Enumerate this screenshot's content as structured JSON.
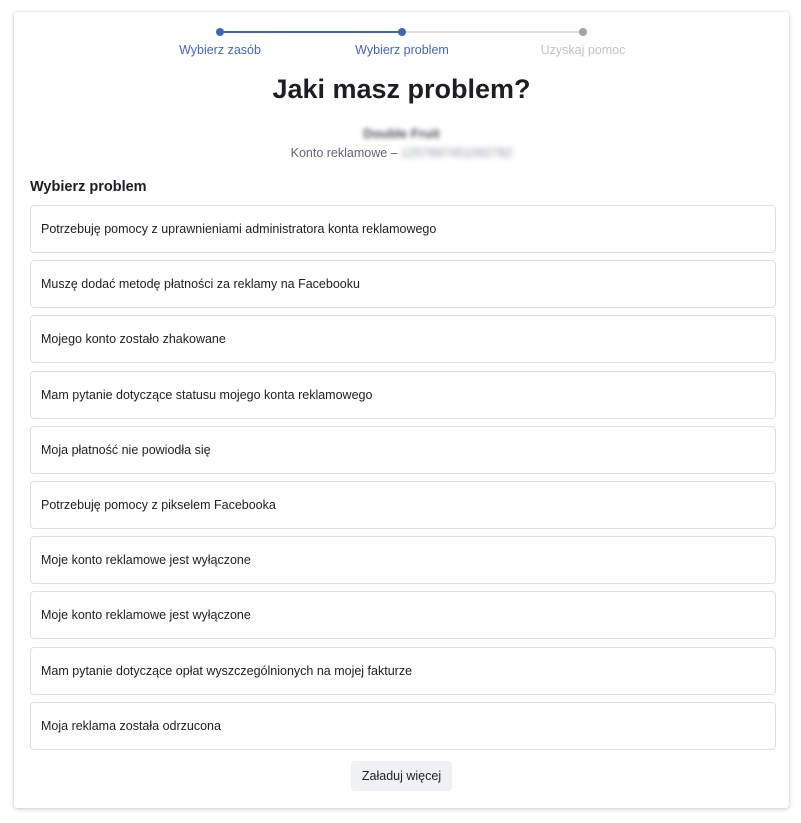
{
  "stepper": {
    "steps": [
      {
        "label": "Wybierz zasób",
        "state": "completed"
      },
      {
        "label": "Wybierz problem",
        "state": "current"
      },
      {
        "label": "Uzyskaj pomoc",
        "state": "upcoming"
      }
    ],
    "colors": {
      "active": "#4267b2",
      "inactive": "#bec3c9"
    }
  },
  "header": {
    "title": "Jaki masz problem?",
    "account_name": "Double Fruit",
    "account_type_label": "Konto reklamowe –",
    "account_id": "1257897451092782"
  },
  "problems": {
    "section_title": "Wybierz problem",
    "items": [
      {
        "label": "Potrzebuję pomocy z uprawnieniami administratora konta reklamowego"
      },
      {
        "label": "Muszę dodać metodę płatności za reklamy na Facebooku"
      },
      {
        "label": "Mojego konto zostało zhakowane"
      },
      {
        "label": "Mam pytanie dotyczące statusu mojego konta reklamowego"
      },
      {
        "label": "Moja płatność nie powiodła się"
      },
      {
        "label": "Potrzebuję pomocy z pikselem Facebooka"
      },
      {
        "label": "Moje konto reklamowe jest wyłączone"
      },
      {
        "label": "Moje konto reklamowe jest wyłączone"
      },
      {
        "label": "Mam pytanie dotyczące opłat wyszczególnionych na mojej fakturze"
      },
      {
        "label": "Moja reklama została odrzucona"
      }
    ],
    "load_more_label": "Załaduj więcej"
  }
}
